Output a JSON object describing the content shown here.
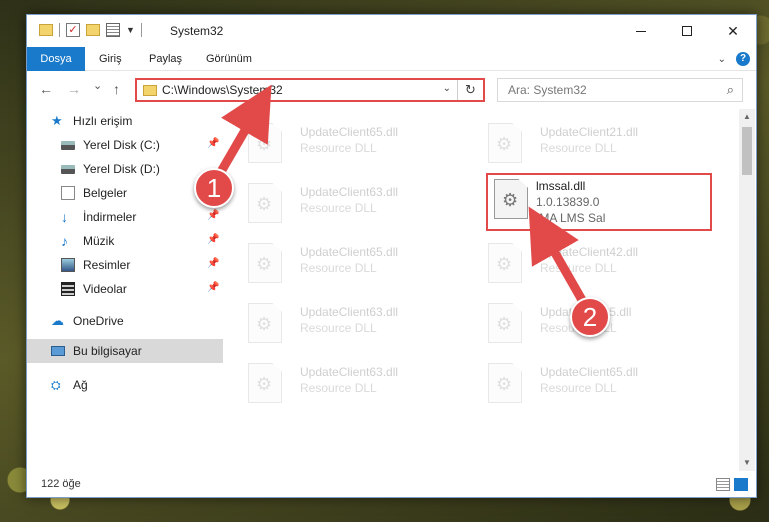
{
  "window": {
    "title": "System32",
    "controls": {
      "minimize": "",
      "maximize": "",
      "close": "✕"
    }
  },
  "ribbon": {
    "tabs": [
      "Dosya",
      "Giriş",
      "Paylaş",
      "Görünüm"
    ]
  },
  "navigation": {
    "back": "←",
    "forward": "→",
    "recent": "⌄",
    "up": "↑",
    "address": "C:\\Windows\\System32",
    "search_placeholder": "Ara: System32"
  },
  "sidebar": {
    "items": [
      {
        "label": "Hızlı erişim",
        "icon": "star-icon"
      },
      {
        "label": "Yerel Disk (C:)",
        "icon": "drive-icon",
        "pinned": true
      },
      {
        "label": "Yerel Disk (D:)",
        "icon": "drive-icon"
      },
      {
        "label": "Belgeler",
        "icon": "documents-icon",
        "pinned": true
      },
      {
        "label": "İndirmeler",
        "icon": "download-icon",
        "pinned": true
      },
      {
        "label": "Müzik",
        "icon": "music-icon",
        "pinned": true
      },
      {
        "label": "Resimler",
        "icon": "pictures-icon",
        "pinned": true
      },
      {
        "label": "Videolar",
        "icon": "videos-icon",
        "pinned": true
      },
      {
        "label": "OneDrive",
        "icon": "cloud-icon"
      },
      {
        "label": "Bu bilgisayar",
        "icon": "computer-icon",
        "selected": true
      },
      {
        "label": "Ağ",
        "icon": "network-icon"
      }
    ]
  },
  "files": {
    "faded": [
      {
        "name": "UpdateClient65.dll",
        "desc": "Resource DLL"
      },
      {
        "name": "UpdateClient21.dll",
        "desc": "Resource DLL"
      },
      {
        "name": "UpdateClient63.dll",
        "desc": "Resource DLL"
      },
      {
        "name": "UpdateClient65.dll",
        "desc": "Resource DLL"
      },
      {
        "name": "UpdateClient42.dll",
        "desc": "Resource DLL"
      },
      {
        "name": "UpdateClient63.dll",
        "desc": "Resource DLL"
      },
      {
        "name": "UpdateClient5.dll",
        "desc": "Resource DLL"
      },
      {
        "name": "UpdateClient63.dll",
        "desc": "Resource DLL"
      },
      {
        "name": "UpdateClient65.dll",
        "desc": "Resource DLL"
      }
    ],
    "highlighted": {
      "name": "lmssal.dll",
      "version": "1.0.13839.0",
      "company": "IMA LMS Sal"
    }
  },
  "status": {
    "item_count": "122 öğe"
  },
  "annotations": {
    "step1": "1",
    "step2": "2",
    "color": "#e24a4a"
  }
}
